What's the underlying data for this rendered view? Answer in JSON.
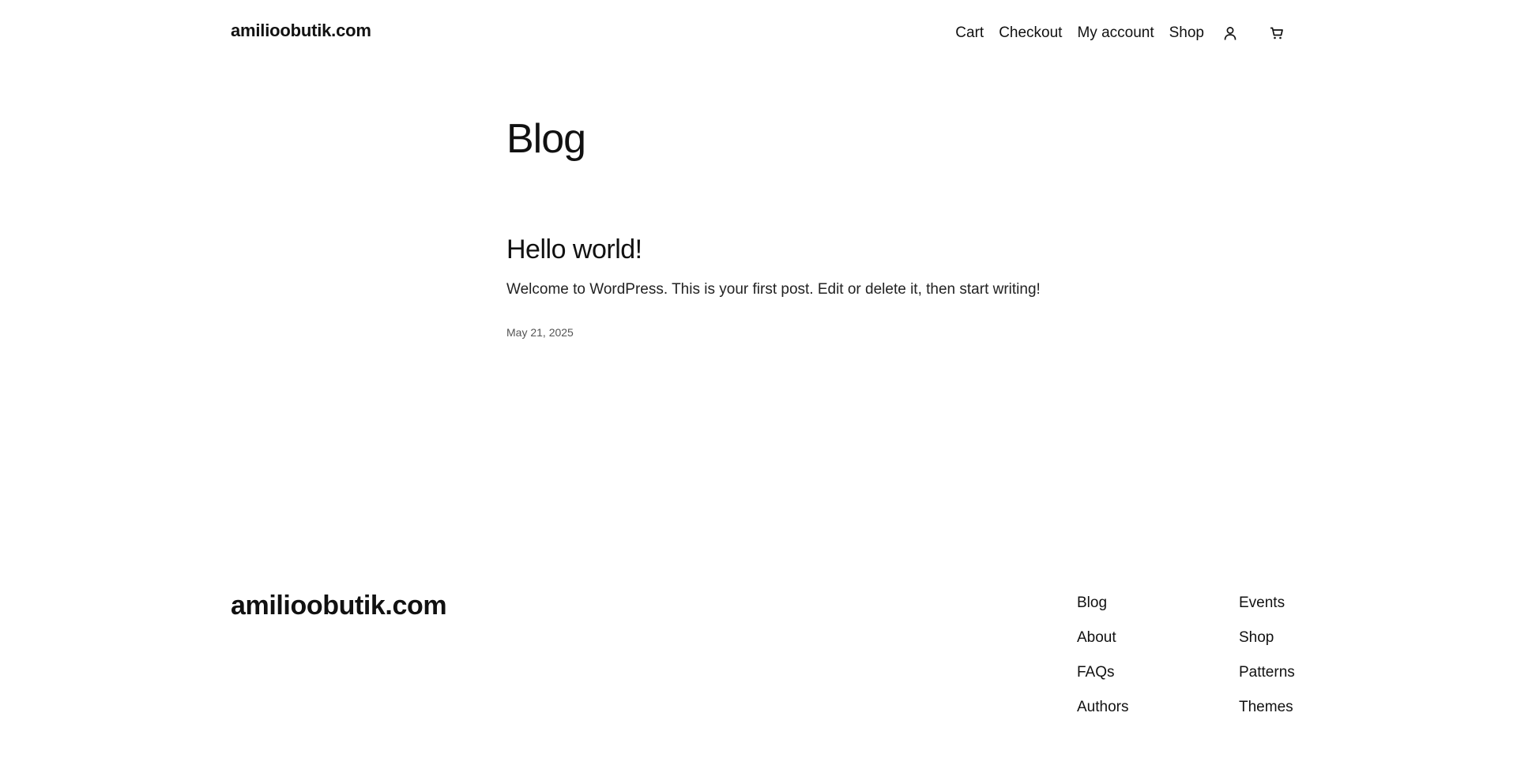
{
  "header": {
    "site_title": "amilioobutik.com",
    "nav": [
      {
        "label": "Cart"
      },
      {
        "label": "Checkout"
      },
      {
        "label": "My account"
      },
      {
        "label": "Shop"
      }
    ],
    "icons": [
      "account-icon",
      "cart-icon"
    ]
  },
  "main": {
    "heading": "Blog",
    "posts": [
      {
        "title": "Hello world!",
        "excerpt": "Welcome to WordPress. This is your first post. Edit or delete it, then start writing!",
        "date": "May 21, 2025"
      }
    ]
  },
  "footer": {
    "site_title": "amilioobutik.com",
    "columns": [
      [
        "Blog",
        "About",
        "FAQs",
        "Authors"
      ],
      [
        "Events",
        "Shop",
        "Patterns",
        "Themes"
      ]
    ]
  },
  "colors": {
    "text": "#111111",
    "background": "#ffffff",
    "muted": "#555555"
  }
}
